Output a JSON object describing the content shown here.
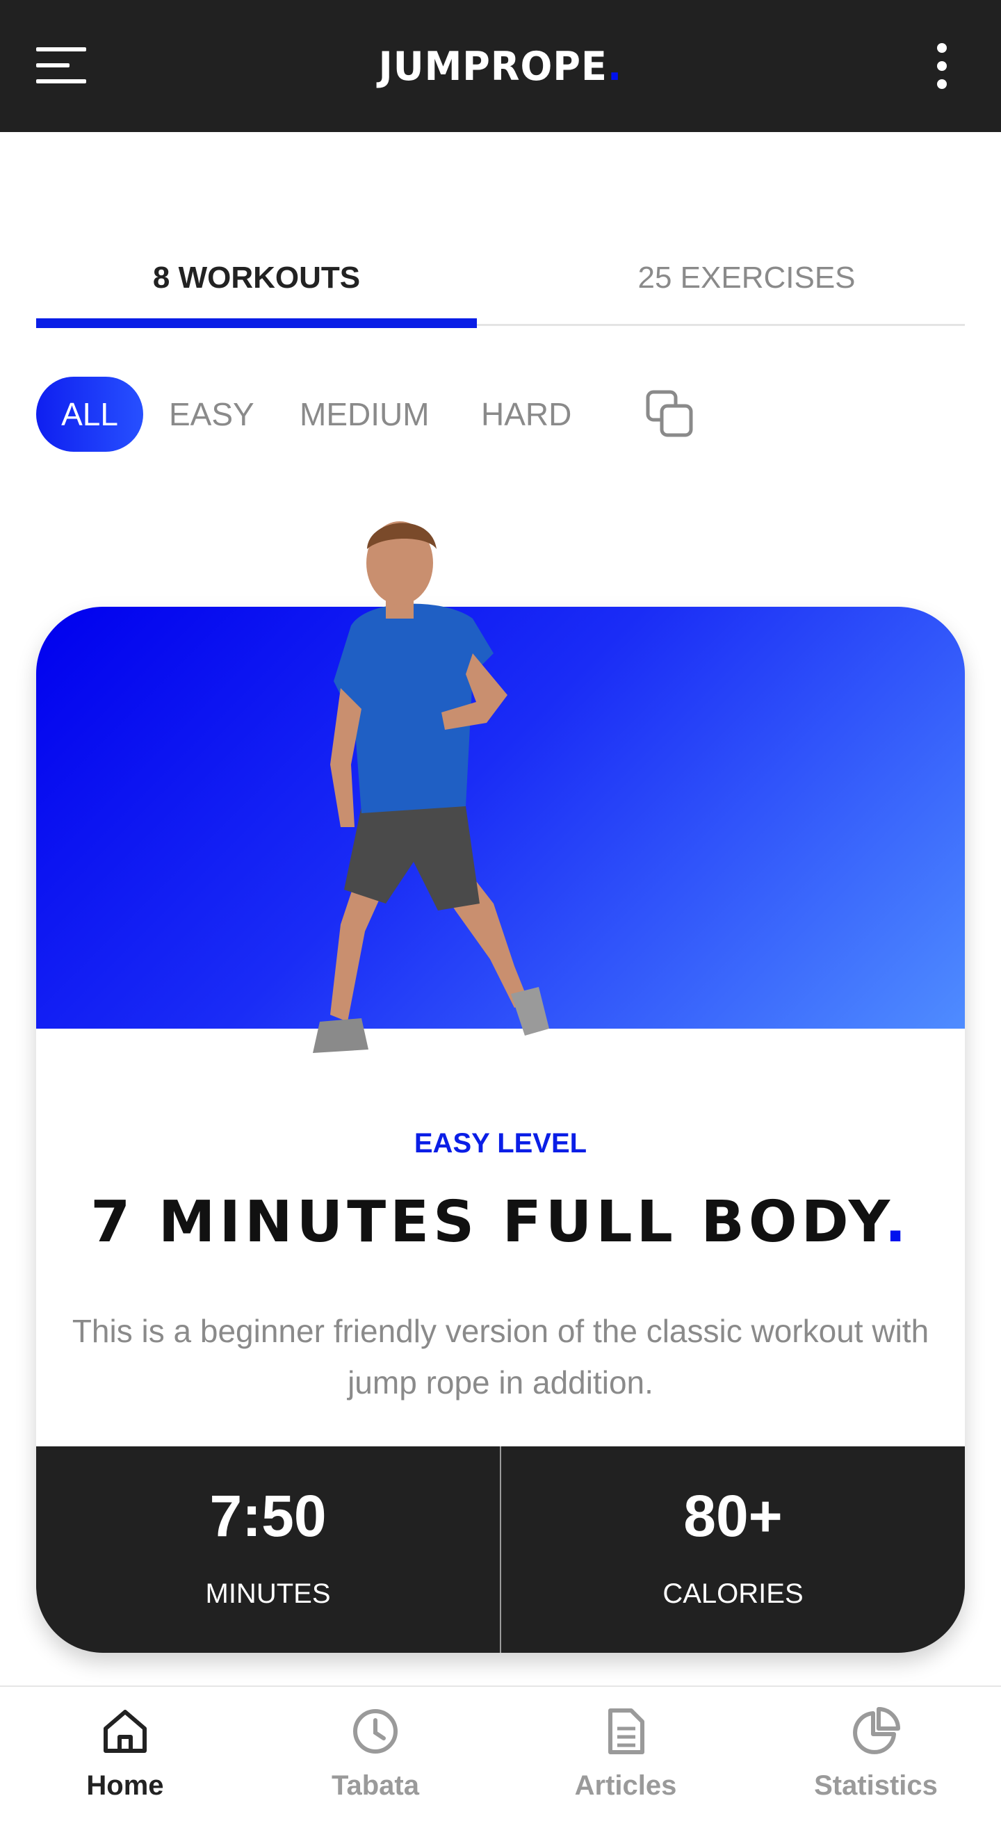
{
  "app_bar": {
    "logo_text": "JUMPROPE",
    "logo_dot": ".",
    "menu_icon": "hamburger-menu-icon",
    "more_icon": "more-vertical-icon"
  },
  "tabs": [
    {
      "label": "8 WORKOUTS",
      "selected": true
    },
    {
      "label": "25 EXERCISES",
      "selected": false
    }
  ],
  "filters": {
    "chips": [
      {
        "label": "ALL",
        "selected": true
      },
      {
        "label": "EASY",
        "selected": false
      },
      {
        "label": "MEDIUM",
        "selected": false
      },
      {
        "label": "HARD",
        "selected": false
      }
    ],
    "copy_icon": "copy-icon"
  },
  "workout_card": {
    "level": "EASY LEVEL",
    "title": "7 MINUTES FULL BODY",
    "title_dot": ".",
    "description": "This is a beginner friendly version of the classic workout with jump rope in addition.",
    "stats": [
      {
        "value": "7:50",
        "label": "MINUTES"
      },
      {
        "value": "80+",
        "label": "CALORIES"
      }
    ]
  },
  "bottom_nav": [
    {
      "label": "Home",
      "icon": "home-icon",
      "active": true
    },
    {
      "label": "Tabata",
      "icon": "clock-icon",
      "active": false
    },
    {
      "label": "Articles",
      "icon": "document-icon",
      "active": false
    },
    {
      "label": "Statistics",
      "icon": "pie-chart-icon",
      "active": false
    }
  ],
  "colors": {
    "accent": "#0a1ee6",
    "app_bar": "#212121",
    "muted_text": "#8a8a8a"
  }
}
